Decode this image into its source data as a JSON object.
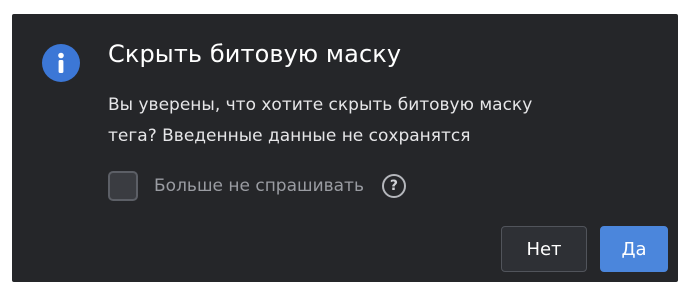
{
  "dialog": {
    "title": "Скрыть битовую маску",
    "message_line1": "Вы уверены, что хотите скрыть битовую маску",
    "message_line2": "тега? Введенные данные не сохранятся",
    "dont_ask_label": "Больше не спрашивать",
    "dont_ask_checked": false,
    "help_glyph": "?",
    "buttons": {
      "no_label": "Нет",
      "yes_label": "Да"
    },
    "icons": {
      "header": "info-icon",
      "help": "question-circle-icon"
    },
    "colors": {
      "background": "#252629",
      "accent": "#4b86dc",
      "info_icon": "#3c77d6"
    }
  }
}
